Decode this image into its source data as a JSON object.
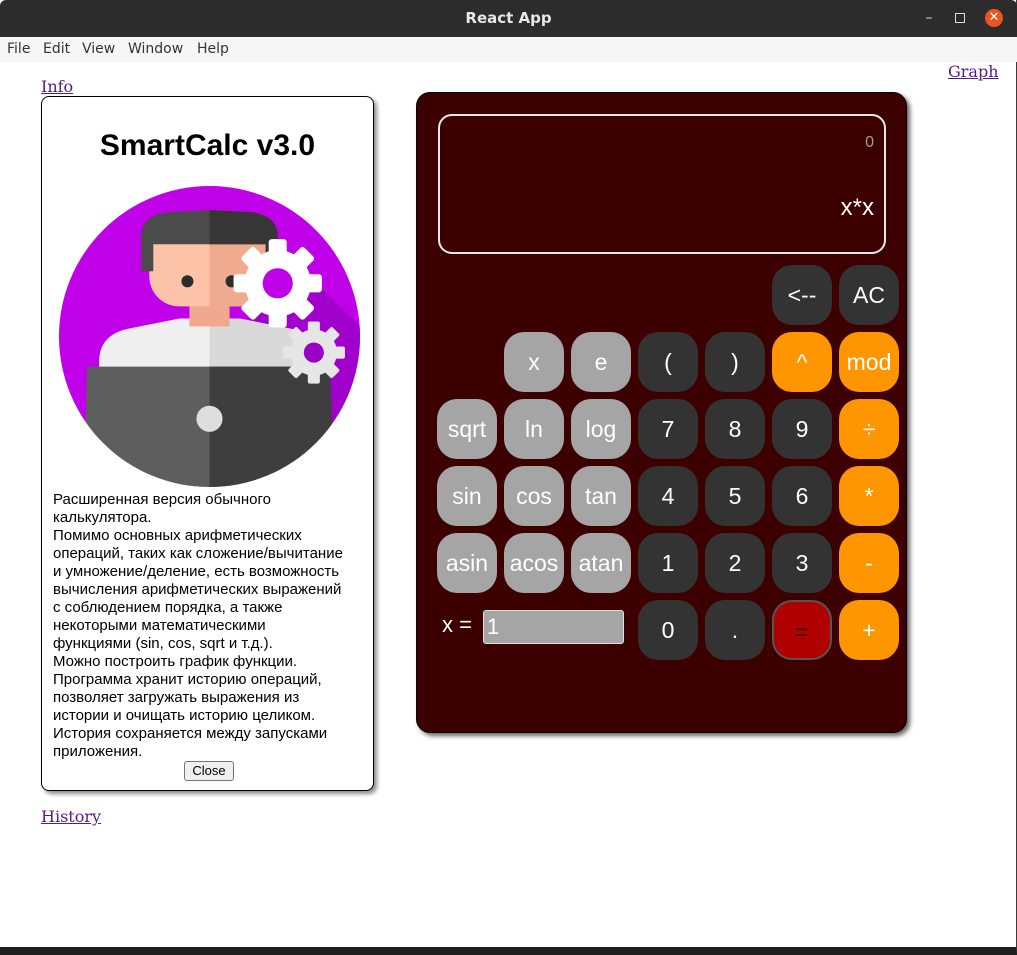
{
  "window": {
    "title": "React App",
    "controls": {
      "minimize": "–",
      "close": "✕"
    }
  },
  "menu": [
    "File",
    "Edit",
    "View",
    "Window",
    "Help"
  ],
  "links": {
    "info": "Info",
    "graph": "Graph",
    "history": "History"
  },
  "info_panel": {
    "title": "SmartCalc v3.0",
    "illustration_icon": "developer-with-laptop-and-gears",
    "text": "Расширенная версия обычного\nкалькулятора.\nПомимо основных арифметических\nопераций, таких как сложение/вычитание\nи умножение/деление, есть возможность\nвычисления арифметических выражений\nс соблюдением порядка, а также\nнекоторыми математическими\nфункциями (sin, cos, sqrt и т.д.).\nМожно построить график функции.\nПрограмма хранит историю операций,\nпозволяет загружать выражения из\nистории и очищать историю целиком.\nИстория сохраняется между запусками\nприложения.",
    "close_label": "Close"
  },
  "calculator": {
    "display": {
      "result": "0",
      "expression": "x*x"
    },
    "keys": {
      "backspace": "<--",
      "ac": "AC",
      "x": "x",
      "e": "e",
      "lparen": "(",
      "rparen": ")",
      "pow": "^",
      "mod": "mod",
      "sqrt": "sqrt",
      "ln": "ln",
      "log": "log",
      "seven": "7",
      "eight": "8",
      "nine": "9",
      "div": "÷",
      "sin": "sin",
      "cos": "cos",
      "tan": "tan",
      "four": "4",
      "five": "5",
      "six": "6",
      "mul": "*",
      "asin": "asin",
      "acos": "acos",
      "atan": "atan",
      "one": "1",
      "two": "2",
      "three": "3",
      "minus": "-",
      "zero": "0",
      "dot": ".",
      "equals": "=",
      "plus": "+"
    },
    "x_label": "x =",
    "x_value": "1",
    "colors": {
      "body": "#3d0000",
      "dark_key": "#333333",
      "gray_key": "#a5a5a5",
      "orange_key": "#ff9500",
      "equals_key": "#b00000"
    }
  }
}
